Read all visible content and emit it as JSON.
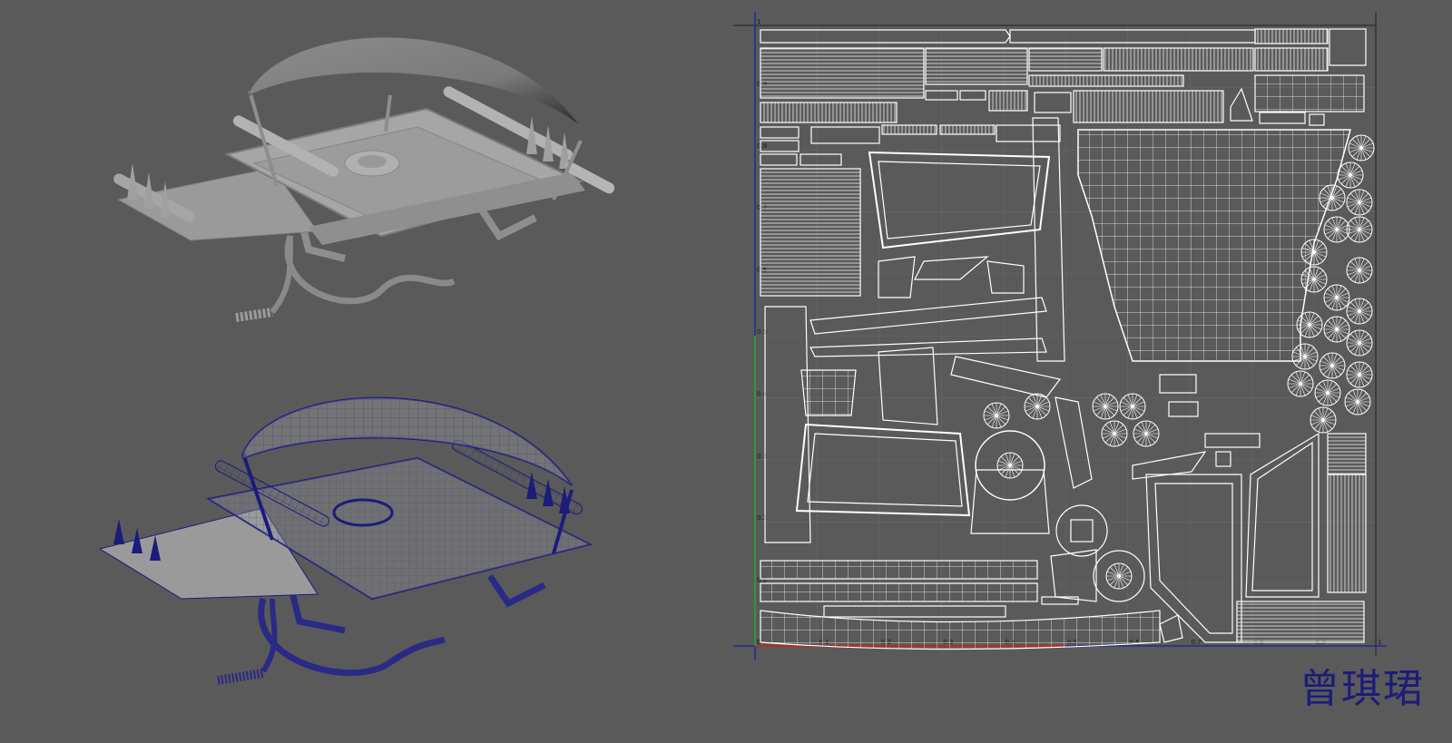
{
  "viewport": {
    "background": "#5a5a5a"
  },
  "views": {
    "shaded_model": {
      "icon": "glider-model-shaded"
    },
    "wireframe_model": {
      "icon": "glider-model-wireframe",
      "wire_color": "#1c1c7a"
    },
    "uv_editor": {
      "icon": "uv-layout",
      "uv_line_color": "#ffffff",
      "grid_color": "#6a6a6a",
      "axis_u_color": "#c0281e",
      "axis_v_color": "#2a9a3a",
      "frame_color": "#1c2a9a",
      "u_ticks": [
        "0",
        "0.1",
        "0.2",
        "0.3",
        "0.4",
        "0.5",
        "0.6",
        "0.7",
        "0.8",
        "0.9",
        "1"
      ],
      "v_ticks": [
        "0",
        "0.1",
        "0.2",
        "0.3",
        "0.4",
        "0.5",
        "0.6",
        "0.7",
        "0.8",
        "0.9",
        "1"
      ]
    }
  },
  "signature": {
    "text": "曾琪珺",
    "color": "#1c1c7a"
  }
}
